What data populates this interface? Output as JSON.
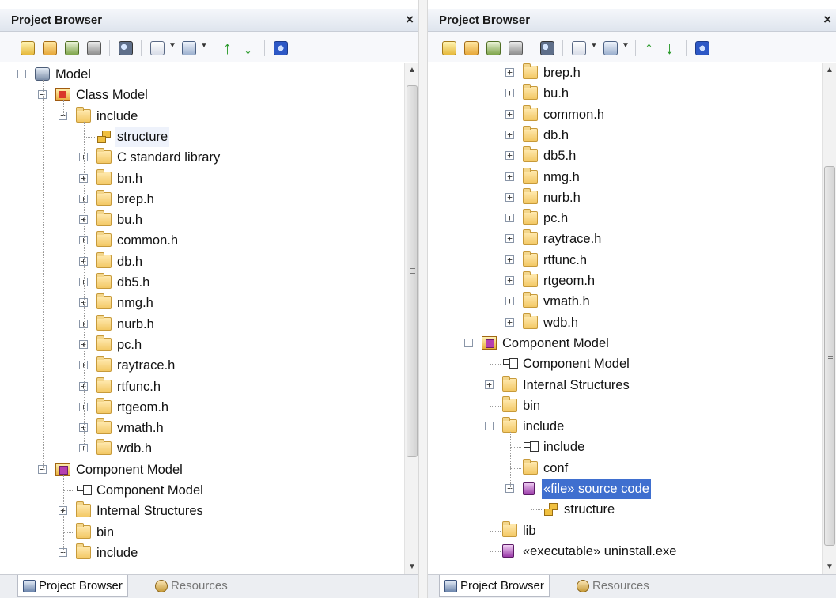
{
  "left": {
    "title": "Project Browser",
    "close": "×",
    "tree": [
      {
        "label": "Model",
        "icon": "model-icon",
        "expander": "−"
      },
      {
        "label": "Class Model",
        "icon": "class-model-icon",
        "expander": "−"
      },
      {
        "label": "include",
        "icon": "folder-icon",
        "expander": "−"
      },
      {
        "label": "structure",
        "icon": "structure-icon",
        "expander": "",
        "highlight": true
      },
      {
        "label": "C standard library",
        "icon": "folder-icon",
        "expander": "+"
      },
      {
        "label": "bn.h",
        "icon": "folder-icon",
        "expander": "+"
      },
      {
        "label": "brep.h",
        "icon": "folder-icon",
        "expander": "+"
      },
      {
        "label": "bu.h",
        "icon": "folder-icon",
        "expander": "+"
      },
      {
        "label": "common.h",
        "icon": "folder-icon",
        "expander": "+"
      },
      {
        "label": "db.h",
        "icon": "folder-icon",
        "expander": "+"
      },
      {
        "label": "db5.h",
        "icon": "folder-icon",
        "expander": "+"
      },
      {
        "label": "nmg.h",
        "icon": "folder-icon",
        "expander": "+"
      },
      {
        "label": "nurb.h",
        "icon": "folder-icon",
        "expander": "+"
      },
      {
        "label": "pc.h",
        "icon": "folder-icon",
        "expander": "+"
      },
      {
        "label": "raytrace.h",
        "icon": "folder-icon",
        "expander": "+"
      },
      {
        "label": "rtfunc.h",
        "icon": "folder-icon",
        "expander": "+"
      },
      {
        "label": "rtgeom.h",
        "icon": "folder-icon",
        "expander": "+"
      },
      {
        "label": "vmath.h",
        "icon": "folder-icon",
        "expander": "+"
      },
      {
        "label": "wdb.h",
        "icon": "folder-icon",
        "expander": "+"
      },
      {
        "label": "Component Model",
        "icon": "component-model-icon",
        "expander": "−"
      },
      {
        "label": "Component Model",
        "icon": "component-diagram-icon",
        "expander": ""
      },
      {
        "label": "Internal Structures",
        "icon": "folder-icon",
        "expander": "+"
      },
      {
        "label": "bin",
        "icon": "folder-icon",
        "expander": ""
      },
      {
        "label": "include",
        "icon": "folder-icon",
        "expander": "−"
      }
    ],
    "tabs": {
      "project_browser": "Project Browser",
      "resources": "Resources"
    }
  },
  "right": {
    "title": "Project Browser",
    "close": "×",
    "tree": [
      {
        "label": "brep.h",
        "icon": "folder-icon",
        "expander": "+"
      },
      {
        "label": "bu.h",
        "icon": "folder-icon",
        "expander": "+"
      },
      {
        "label": "common.h",
        "icon": "folder-icon",
        "expander": "+"
      },
      {
        "label": "db.h",
        "icon": "folder-icon",
        "expander": "+"
      },
      {
        "label": "db5.h",
        "icon": "folder-icon",
        "expander": "+"
      },
      {
        "label": "nmg.h",
        "icon": "folder-icon",
        "expander": "+"
      },
      {
        "label": "nurb.h",
        "icon": "folder-icon",
        "expander": "+"
      },
      {
        "label": "pc.h",
        "icon": "folder-icon",
        "expander": "+"
      },
      {
        "label": "raytrace.h",
        "icon": "folder-icon",
        "expander": "+"
      },
      {
        "label": "rtfunc.h",
        "icon": "folder-icon",
        "expander": "+"
      },
      {
        "label": "rtgeom.h",
        "icon": "folder-icon",
        "expander": "+"
      },
      {
        "label": "vmath.h",
        "icon": "folder-icon",
        "expander": "+"
      },
      {
        "label": "wdb.h",
        "icon": "folder-icon",
        "expander": "+"
      },
      {
        "label": "Component Model",
        "icon": "component-model-icon",
        "expander": "−"
      },
      {
        "label": "Component Model",
        "icon": "component-diagram-icon",
        "expander": ""
      },
      {
        "label": "Internal Structures",
        "icon": "folder-icon",
        "expander": "+"
      },
      {
        "label": "bin",
        "icon": "folder-icon",
        "expander": ""
      },
      {
        "label": "include",
        "icon": "folder-icon",
        "expander": "−"
      },
      {
        "label": "include",
        "icon": "component-diagram-icon",
        "expander": ""
      },
      {
        "label": "conf",
        "icon": "folder-icon",
        "expander": ""
      },
      {
        "label": "«file» source code",
        "icon": "artifact-icon",
        "expander": "−",
        "selected": true
      },
      {
        "label": "structure",
        "icon": "structure-icon",
        "expander": ""
      },
      {
        "label": "lib",
        "icon": "folder-icon",
        "expander": ""
      },
      {
        "label": "«executable» uninstall.exe",
        "icon": "artifact-icon",
        "expander": ""
      }
    ],
    "tabs": {
      "project_browser": "Project Browser",
      "resources": "Resources"
    }
  },
  "colors": {
    "selection": "#3f6fcf",
    "titlebar": "#dfe5ee",
    "folder": "#f3c865"
  }
}
